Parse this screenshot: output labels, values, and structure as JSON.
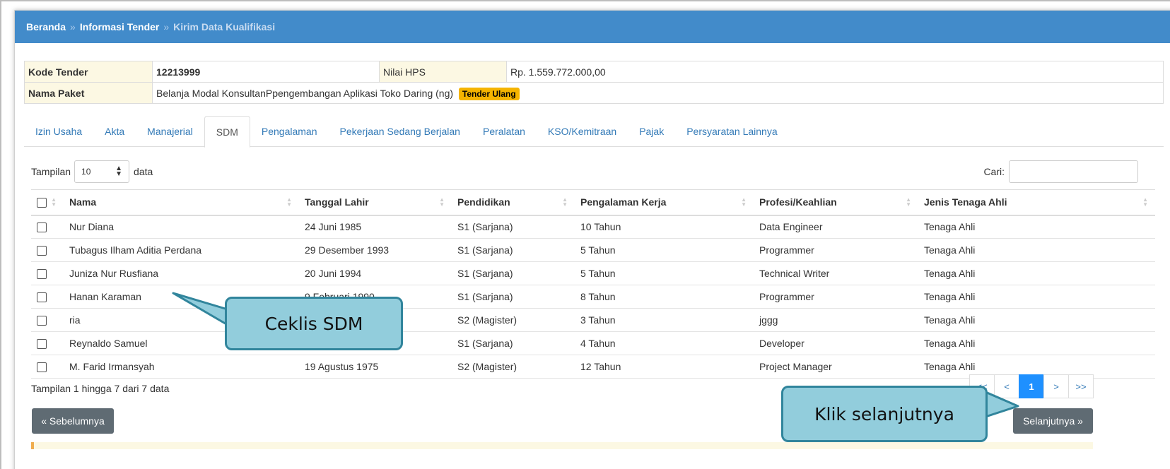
{
  "breadcrumb": {
    "home": "Beranda",
    "sep": "»",
    "info": "Informasi Tender",
    "current": "Kirim Data Kualifikasi"
  },
  "tender": {
    "kode_label": "Kode Tender",
    "kode_value": "12213999",
    "hps_label": "Nilai HPS",
    "hps_value": "Rp. 1.559.772.000,00",
    "paket_label": "Nama Paket",
    "paket_value": "Belanja Modal KonsultanPpengembangan Aplikasi Toko Daring (ng)",
    "badge": "Tender Ulang"
  },
  "tabs": [
    "Izin Usaha",
    "Akta",
    "Manajerial",
    "SDM",
    "Pengalaman",
    "Pekerjaan Sedang Berjalan",
    "Peralatan",
    "KSO/Kemitraan",
    "Pajak",
    "Persyaratan Lainnya"
  ],
  "active_tab": "SDM",
  "controls": {
    "show_label": "Tampilan",
    "page_size": "10",
    "data_label": "data",
    "search_label": "Cari:",
    "search_value": ""
  },
  "table": {
    "headers": [
      "Nama",
      "Tanggal Lahir",
      "Pendidikan",
      "Pengalaman Kerja",
      "Profesi/Keahlian",
      "Jenis Tenaga Ahli"
    ],
    "rows": [
      [
        "Nur Diana",
        "24 Juni 1985",
        "S1 (Sarjana)",
        "10 Tahun",
        "Data Engineer",
        "Tenaga Ahli"
      ],
      [
        "Tubagus Ilham Aditia Perdana",
        "29 Desember 1993",
        "S1 (Sarjana)",
        "5 Tahun",
        "Programmer",
        "Tenaga Ahli"
      ],
      [
        "Juniza Nur Rusfiana",
        "20 Juni 1994",
        "S1 (Sarjana)",
        "5 Tahun",
        "Technical Writer",
        "Tenaga Ahli"
      ],
      [
        "Hanan Karaman",
        "9 Februari 1990",
        "S1 (Sarjana)",
        "8 Tahun",
        "Programmer",
        "Tenaga Ahli"
      ],
      [
        "ria",
        "",
        "S2 (Magister)",
        "3 Tahun",
        "jggg",
        "Tenaga Ahli"
      ],
      [
        "Reynaldo Samuel",
        "",
        "S1 (Sarjana)",
        "4 Tahun",
        "Developer",
        "Tenaga Ahli"
      ],
      [
        "M. Farid Irmansyah",
        "19 Agustus 1975",
        "S2 (Magister)",
        "12 Tahun",
        "Project Manager",
        "Tenaga Ahli"
      ]
    ]
  },
  "footer": {
    "info": "Tampilan 1 hingga 7 dari 7 data"
  },
  "pagination": {
    "first": "<<",
    "prev": "<",
    "current": "1",
    "next": ">",
    "last": ">>"
  },
  "buttons": {
    "prev": "« Sebelumnya",
    "next": "Selanjutnya »"
  },
  "callouts": {
    "check": "Ceklis SDM",
    "next": "Klik selanjutnya"
  },
  "colors": {
    "header_blue": "#428bca",
    "callout_fill": "#92cddc",
    "callout_border": "#31859c",
    "badge": "#f5b400"
  }
}
